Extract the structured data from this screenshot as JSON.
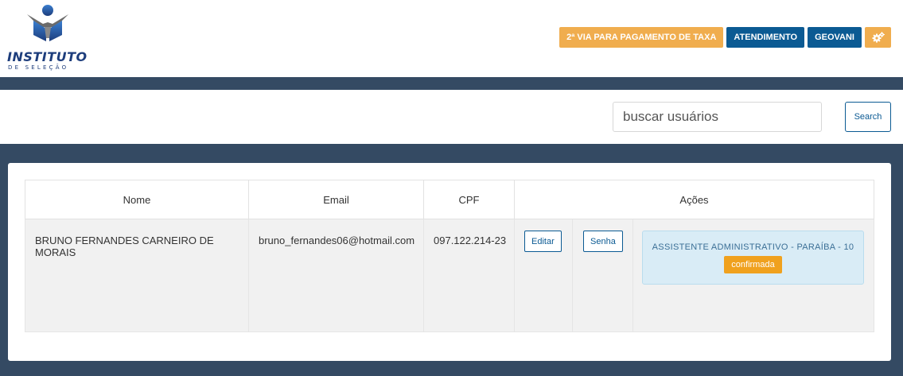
{
  "logo": {
    "title": "INSTITUTO",
    "subtitle": "DE SELEÇÃO"
  },
  "nav": {
    "taxa_label": "2ª VIA PARA PAGAMENTO DE TAXA",
    "atendimento_label": "ATENDIMENTO",
    "user_label": "GEOVANI",
    "settings_icon": "cogs-icon"
  },
  "search": {
    "placeholder": "buscar usuários",
    "button_label": "Search"
  },
  "table": {
    "headers": [
      "Nome",
      "Email",
      "CPF",
      "Ações"
    ],
    "rows": [
      {
        "nome": "BRUNO FERNANDES CARNEIRO DE MORAIS",
        "email": "bruno_fernandes06@hotmail.com",
        "cpf": "097.122.214-23",
        "editar": "Editar",
        "senha": "Senha",
        "inscricao": "ASSISTENTE ADMINISTRATIVO - PARAÍBA - 10",
        "status": "confirmada"
      }
    ]
  },
  "colors": {
    "navy": "#344a63",
    "blue": "#0b5a93",
    "orange": "#f0ad4e"
  }
}
